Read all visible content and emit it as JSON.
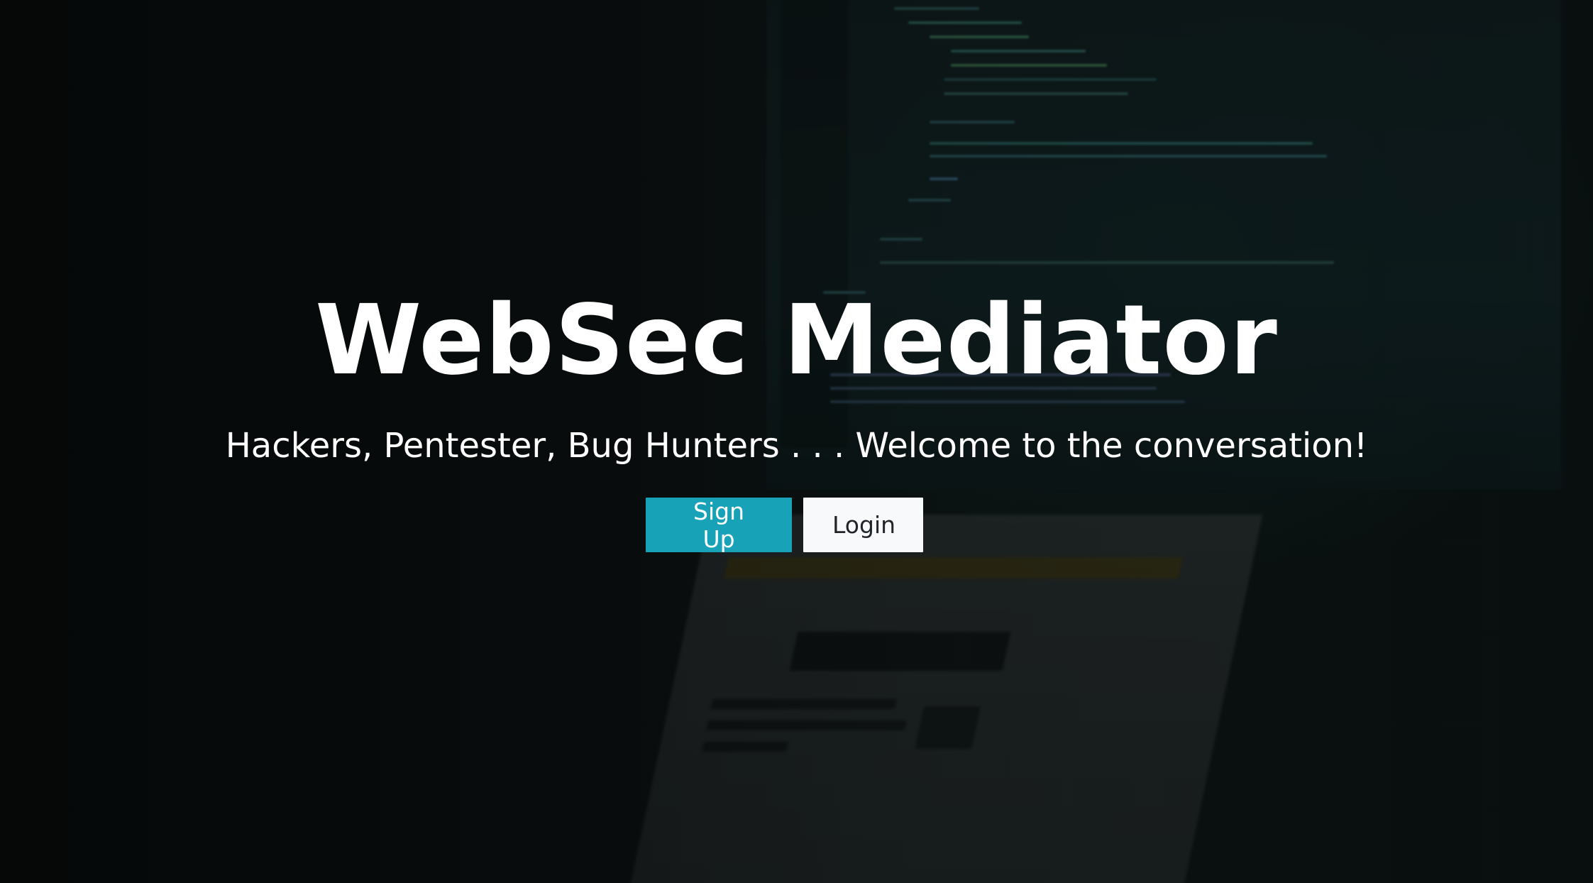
{
  "hero": {
    "title": "WebSec Mediator",
    "subtitle": "Hackers, Pentester, Bug Hunters . . . Welcome to the conversation!",
    "signup_label": "Sign Up",
    "login_label": "Login"
  },
  "colors": {
    "signup_button": "#17a2b8",
    "login_button": "#f8f9fa",
    "text": "#ffffff",
    "background": "#070b0b"
  }
}
